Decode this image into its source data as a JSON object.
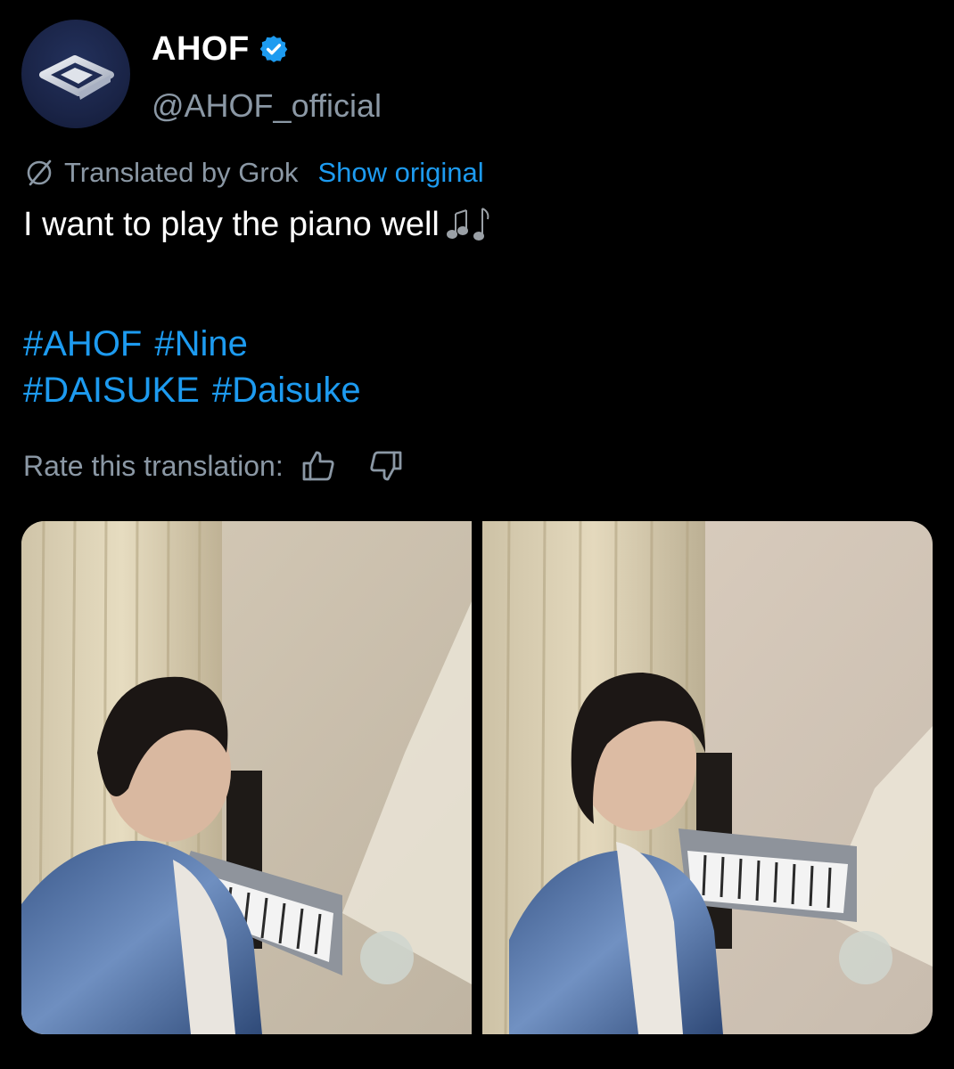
{
  "author": {
    "display_name": "AHOF",
    "handle": "@AHOF_official",
    "verified": true,
    "avatar_icon": "ahof-logo-icon"
  },
  "translation": {
    "label": "Translated by Grok",
    "show_original": "Show original",
    "rate_label": "Rate this translation:"
  },
  "tweet": {
    "text": "I want to play the piano well",
    "emoji": "musical-notes-icon",
    "hashtag_lines": [
      [
        "#AHOF",
        "#Nine"
      ],
      [
        "#DAISUKE",
        "#Daisuke"
      ]
    ]
  },
  "media": [
    {
      "alt_icon": "photo-piano-laughing"
    },
    {
      "alt_icon": "photo-piano-smiling"
    }
  ],
  "colors": {
    "background": "#000000",
    "text": "#ffffff",
    "secondary": "#8b98a5",
    "link": "#1d9bf0"
  }
}
